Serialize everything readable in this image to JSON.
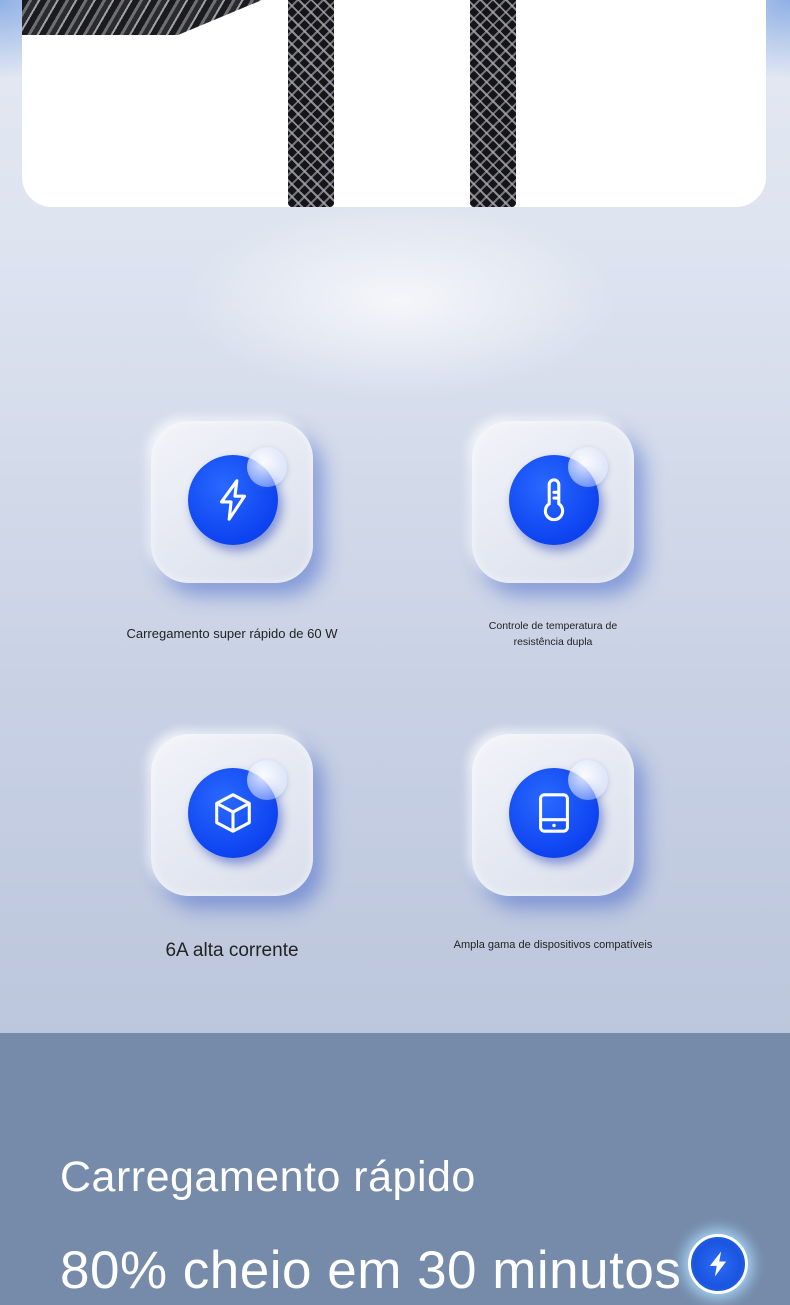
{
  "features": [
    {
      "label": "Carregamento super rápido de 60 W",
      "icon": "lightning-icon"
    },
    {
      "label": "Controle de temperatura de resistência dupla",
      "icon": "thermometer-icon"
    },
    {
      "label": "6A alta corrente",
      "icon": "cube-icon"
    },
    {
      "label": "Ampla gama de dispositivos compatíveis",
      "icon": "tablet-icon"
    }
  ],
  "promo": {
    "headline": "Carregamento rápido",
    "subline": "80% cheio em 30 minutos",
    "badge_icon": "lightning-badge-icon"
  },
  "colors": {
    "accent": "#0d43f0",
    "panel": "#768aa9"
  }
}
